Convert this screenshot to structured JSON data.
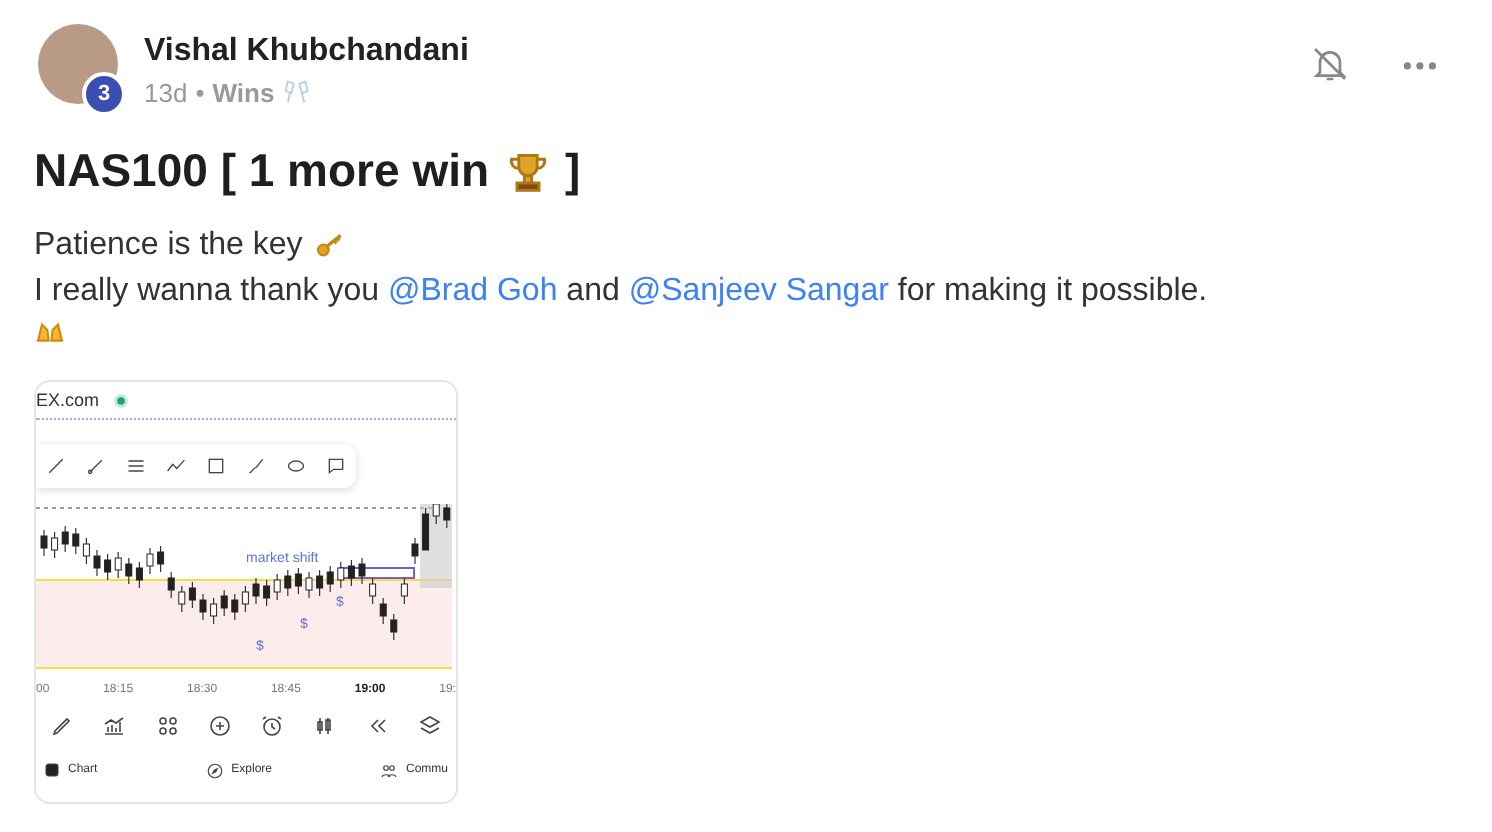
{
  "post": {
    "author": "Vishal Khubchandani",
    "level_badge": "3",
    "age": "13d",
    "separator": "•",
    "category": "Wins",
    "title_start": "NAS100 [ 1 more win",
    "title_end": "]",
    "lines": [
      "Patience is the key",
      "I really wanna thank you **@Brad Goh** and **@Sanjeev Sangar** for making it possible."
    ]
  },
  "attachment": {
    "site": "EX.com",
    "annotation": "market shift",
    "dollar_marks": [
      "$",
      "$",
      "$"
    ],
    "times": [
      {
        "label": "00",
        "bold": false
      },
      {
        "label": "18:15",
        "bold": false
      },
      {
        "label": "18:30",
        "bold": false
      },
      {
        "label": "18:45",
        "bold": false
      },
      {
        "label": "19:00",
        "bold": true
      },
      {
        "label": "19:",
        "bold": false
      }
    ],
    "nav": [
      "Chart",
      "Explore",
      "Commu"
    ]
  }
}
